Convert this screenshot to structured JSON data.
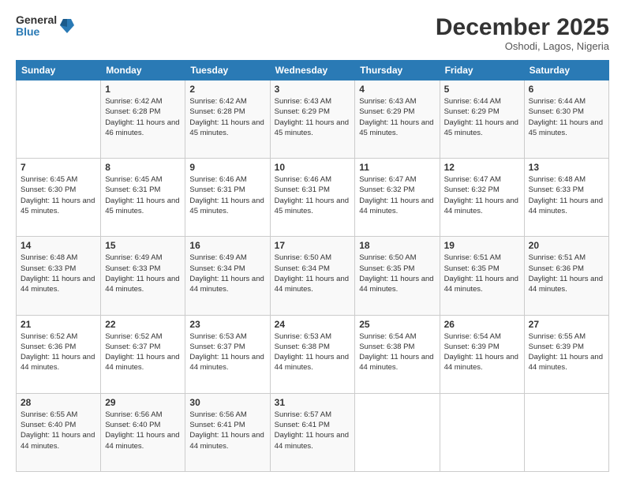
{
  "header": {
    "logo_general": "General",
    "logo_blue": "Blue",
    "month": "December 2025",
    "location": "Oshodi, Lagos, Nigeria"
  },
  "days_of_week": [
    "Sunday",
    "Monday",
    "Tuesday",
    "Wednesday",
    "Thursday",
    "Friday",
    "Saturday"
  ],
  "weeks": [
    [
      {
        "day": "",
        "sunrise": "",
        "sunset": "",
        "daylight": ""
      },
      {
        "day": "1",
        "sunrise": "6:42 AM",
        "sunset": "6:28 PM",
        "daylight": "11 hours and 46 minutes."
      },
      {
        "day": "2",
        "sunrise": "6:42 AM",
        "sunset": "6:28 PM",
        "daylight": "11 hours and 45 minutes."
      },
      {
        "day": "3",
        "sunrise": "6:43 AM",
        "sunset": "6:29 PM",
        "daylight": "11 hours and 45 minutes."
      },
      {
        "day": "4",
        "sunrise": "6:43 AM",
        "sunset": "6:29 PM",
        "daylight": "11 hours and 45 minutes."
      },
      {
        "day": "5",
        "sunrise": "6:44 AM",
        "sunset": "6:29 PM",
        "daylight": "11 hours and 45 minutes."
      },
      {
        "day": "6",
        "sunrise": "6:44 AM",
        "sunset": "6:30 PM",
        "daylight": "11 hours and 45 minutes."
      }
    ],
    [
      {
        "day": "7",
        "sunrise": "6:45 AM",
        "sunset": "6:30 PM",
        "daylight": "11 hours and 45 minutes."
      },
      {
        "day": "8",
        "sunrise": "6:45 AM",
        "sunset": "6:31 PM",
        "daylight": "11 hours and 45 minutes."
      },
      {
        "day": "9",
        "sunrise": "6:46 AM",
        "sunset": "6:31 PM",
        "daylight": "11 hours and 45 minutes."
      },
      {
        "day": "10",
        "sunrise": "6:46 AM",
        "sunset": "6:31 PM",
        "daylight": "11 hours and 45 minutes."
      },
      {
        "day": "11",
        "sunrise": "6:47 AM",
        "sunset": "6:32 PM",
        "daylight": "11 hours and 44 minutes."
      },
      {
        "day": "12",
        "sunrise": "6:47 AM",
        "sunset": "6:32 PM",
        "daylight": "11 hours and 44 minutes."
      },
      {
        "day": "13",
        "sunrise": "6:48 AM",
        "sunset": "6:33 PM",
        "daylight": "11 hours and 44 minutes."
      }
    ],
    [
      {
        "day": "14",
        "sunrise": "6:48 AM",
        "sunset": "6:33 PM",
        "daylight": "11 hours and 44 minutes."
      },
      {
        "day": "15",
        "sunrise": "6:49 AM",
        "sunset": "6:33 PM",
        "daylight": "11 hours and 44 minutes."
      },
      {
        "day": "16",
        "sunrise": "6:49 AM",
        "sunset": "6:34 PM",
        "daylight": "11 hours and 44 minutes."
      },
      {
        "day": "17",
        "sunrise": "6:50 AM",
        "sunset": "6:34 PM",
        "daylight": "11 hours and 44 minutes."
      },
      {
        "day": "18",
        "sunrise": "6:50 AM",
        "sunset": "6:35 PM",
        "daylight": "11 hours and 44 minutes."
      },
      {
        "day": "19",
        "sunrise": "6:51 AM",
        "sunset": "6:35 PM",
        "daylight": "11 hours and 44 minutes."
      },
      {
        "day": "20",
        "sunrise": "6:51 AM",
        "sunset": "6:36 PM",
        "daylight": "11 hours and 44 minutes."
      }
    ],
    [
      {
        "day": "21",
        "sunrise": "6:52 AM",
        "sunset": "6:36 PM",
        "daylight": "11 hours and 44 minutes."
      },
      {
        "day": "22",
        "sunrise": "6:52 AM",
        "sunset": "6:37 PM",
        "daylight": "11 hours and 44 minutes."
      },
      {
        "day": "23",
        "sunrise": "6:53 AM",
        "sunset": "6:37 PM",
        "daylight": "11 hours and 44 minutes."
      },
      {
        "day": "24",
        "sunrise": "6:53 AM",
        "sunset": "6:38 PM",
        "daylight": "11 hours and 44 minutes."
      },
      {
        "day": "25",
        "sunrise": "6:54 AM",
        "sunset": "6:38 PM",
        "daylight": "11 hours and 44 minutes."
      },
      {
        "day": "26",
        "sunrise": "6:54 AM",
        "sunset": "6:39 PM",
        "daylight": "11 hours and 44 minutes."
      },
      {
        "day": "27",
        "sunrise": "6:55 AM",
        "sunset": "6:39 PM",
        "daylight": "11 hours and 44 minutes."
      }
    ],
    [
      {
        "day": "28",
        "sunrise": "6:55 AM",
        "sunset": "6:40 PM",
        "daylight": "11 hours and 44 minutes."
      },
      {
        "day": "29",
        "sunrise": "6:56 AM",
        "sunset": "6:40 PM",
        "daylight": "11 hours and 44 minutes."
      },
      {
        "day": "30",
        "sunrise": "6:56 AM",
        "sunset": "6:41 PM",
        "daylight": "11 hours and 44 minutes."
      },
      {
        "day": "31",
        "sunrise": "6:57 AM",
        "sunset": "6:41 PM",
        "daylight": "11 hours and 44 minutes."
      },
      {
        "day": "",
        "sunrise": "",
        "sunset": "",
        "daylight": ""
      },
      {
        "day": "",
        "sunrise": "",
        "sunset": "",
        "daylight": ""
      },
      {
        "day": "",
        "sunrise": "",
        "sunset": "",
        "daylight": ""
      }
    ]
  ],
  "labels": {
    "sunrise": "Sunrise:",
    "sunset": "Sunset:",
    "daylight": "Daylight:"
  }
}
